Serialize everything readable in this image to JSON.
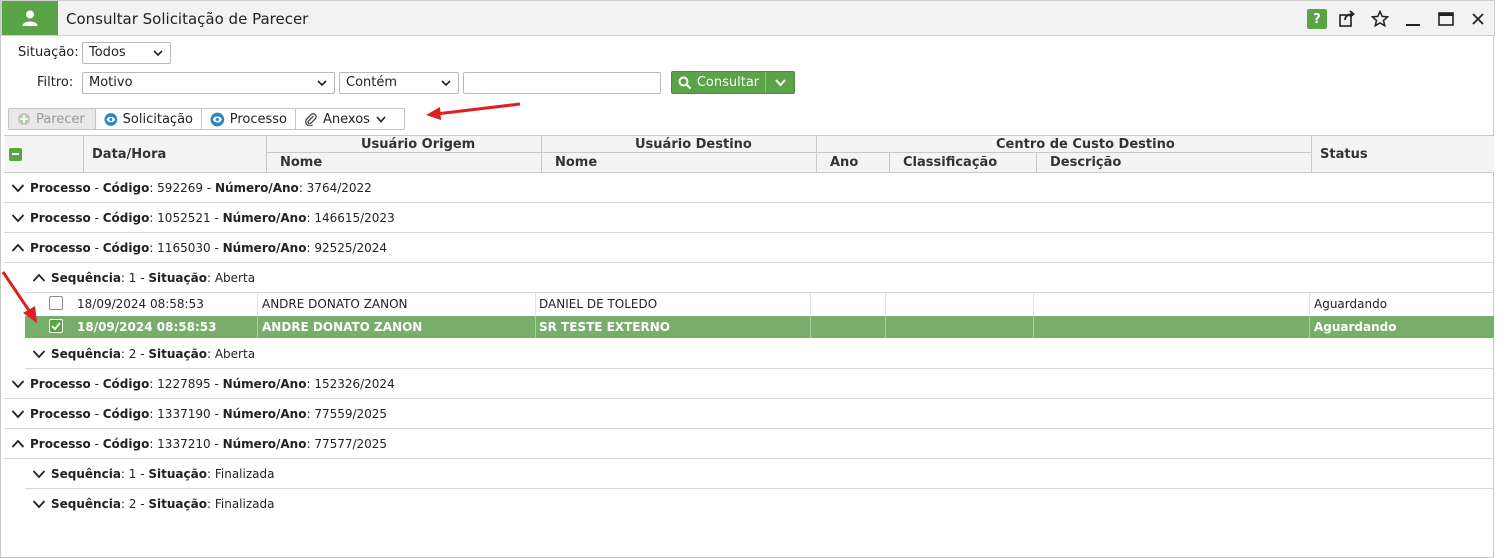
{
  "window": {
    "title": "Consultar Solicitação de Parecer",
    "controls": {
      "help": "?"
    }
  },
  "filters": {
    "situacao_label": "Situação:",
    "situacao_value": "Todos",
    "filtro_label": "Filtro:",
    "field_value": "Motivo",
    "operator_value": "Contém",
    "text_value": "",
    "consult_label": "Consultar"
  },
  "toolbar": {
    "parecer": "Parecer",
    "solicitacao": "Solicitação",
    "processo": "Processo",
    "anexos": "Anexos"
  },
  "grid": {
    "headers": {
      "data_hora": "Data/Hora",
      "usuario_origem": "Usuário Origem",
      "usuario_destino": "Usuário Destino",
      "centro_custo": "Centro de Custo Destino",
      "nome": "Nome",
      "nome2": "Nome",
      "ano": "Ano",
      "classificacao": "Classificação",
      "descricao": "Descrição",
      "status": "Status"
    },
    "labels": {
      "processo": "Processo",
      "codigo": "Código",
      "numero_ano": "Número/Ano",
      "sequencia": "Sequência",
      "situacao": "Situação"
    },
    "processes": [
      {
        "codigo": "592269",
        "numero_ano": "3764/2022"
      },
      {
        "codigo": "1052521",
        "numero_ano": "146615/2023"
      },
      {
        "codigo": "1165030",
        "numero_ano": "92525/2024"
      },
      {
        "codigo": "1227895",
        "numero_ano": "152326/2024"
      },
      {
        "codigo": "1337190",
        "numero_ano": "77559/2025"
      },
      {
        "codigo": "1337210",
        "numero_ano": "77577/2025"
      }
    ],
    "sequences": [
      {
        "seq": "1",
        "situacao": "Aberta"
      },
      {
        "seq": "2",
        "situacao": "Aberta"
      },
      {
        "seq": "1",
        "situacao": "Finalizada"
      },
      {
        "seq": "2",
        "situacao": "Finalizada"
      }
    ],
    "rows": [
      {
        "data_hora": "18/09/2024 08:58:53",
        "origem": "ANDRE DONATO ZANON",
        "destino": "DANIEL DE TOLEDO",
        "ano": "",
        "classificacao": "",
        "descricao": "",
        "status": "Aguardando",
        "checked": false
      },
      {
        "data_hora": "18/09/2024 08:58:53",
        "origem": "ANDRE DONATO ZANON",
        "destino": "SR TESTE EXTERNO",
        "ano": "",
        "classificacao": "",
        "descricao": "",
        "status": "Aguardando",
        "checked": true
      }
    ]
  },
  "colors": {
    "accent": "#5aa347",
    "selected_row": "#78ad6b",
    "annotation_arrow": "#e02020"
  }
}
